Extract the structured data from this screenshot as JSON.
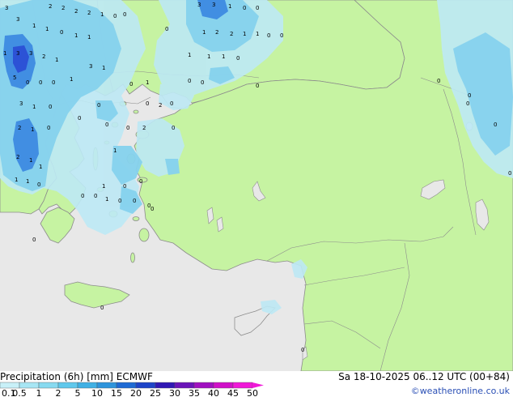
{
  "header": {
    "title": "Precipitation (6h) [mm] ECMWF",
    "valid_time": "Sa 18-10-2025 06..12 UTC (00+84)",
    "credit": "©weatheronline.co.uk"
  },
  "legend": {
    "ticks": [
      "0.1",
      "0.5",
      "1",
      "2",
      "5",
      "10",
      "15",
      "20",
      "25",
      "30",
      "35",
      "40",
      "45",
      "50"
    ],
    "colors": [
      "#c8f0f8",
      "#a8e6f4",
      "#88daf0",
      "#60c8ec",
      "#40b0e4",
      "#2e94dc",
      "#1e6ad4",
      "#1e44c8",
      "#3018b4",
      "#6a14b8",
      "#a010c0",
      "#d010c8",
      "#f018d8"
    ]
  },
  "colors": {
    "sea": "#e8e8e8",
    "land": "#c6f3a2",
    "coast": "#8c8c8c",
    "rain_light": "#bde9f5",
    "rain_mid": "#86d2ee",
    "rain_heavy": "#3a86e0",
    "rain_core": "#2c52d6",
    "credit": "#2a4fb5"
  },
  "map": {
    "values": [
      {
        "t": "3"
      },
      {
        "t": "2"
      },
      {
        "t": "2"
      },
      {
        "t": "2"
      },
      {
        "t": "2"
      },
      {
        "t": "1"
      },
      {
        "t": "0"
      },
      {
        "t": "0"
      },
      {
        "t": "3"
      },
      {
        "t": "3"
      },
      {
        "t": "1"
      },
      {
        "t": "0"
      },
      {
        "t": "0"
      },
      {
        "t": "3"
      },
      {
        "t": "1"
      },
      {
        "t": "1"
      },
      {
        "t": "0"
      },
      {
        "t": "1"
      },
      {
        "t": "1"
      },
      {
        "t": "1"
      },
      {
        "t": "2"
      },
      {
        "t": "2"
      },
      {
        "t": "1"
      },
      {
        "t": "1"
      },
      {
        "t": "0"
      },
      {
        "t": "0"
      },
      {
        "t": "0"
      },
      {
        "t": "1"
      },
      {
        "t": "1"
      },
      {
        "t": "1"
      },
      {
        "t": "0"
      },
      {
        "t": "1"
      },
      {
        "t": "3"
      },
      {
        "t": "3"
      },
      {
        "t": "2"
      },
      {
        "t": "1"
      },
      {
        "t": "3"
      },
      {
        "t": "1"
      },
      {
        "t": "5"
      },
      {
        "t": "0"
      },
      {
        "t": "0"
      },
      {
        "t": "0"
      },
      {
        "t": "1"
      },
      {
        "t": "0"
      },
      {
        "t": "1"
      },
      {
        "t": "0"
      },
      {
        "t": "0"
      },
      {
        "t": "3"
      },
      {
        "t": "1"
      },
      {
        "t": "0"
      },
      {
        "t": "0"
      },
      {
        "t": "2"
      },
      {
        "t": "0"
      },
      {
        "t": "2"
      },
      {
        "t": "1"
      },
      {
        "t": "0"
      },
      {
        "t": "2"
      },
      {
        "t": "0"
      },
      {
        "t": "0"
      },
      {
        "t": "0"
      },
      {
        "t": "0"
      },
      {
        "t": "0"
      },
      {
        "t": "1"
      },
      {
        "t": "2"
      },
      {
        "t": "1"
      },
      {
        "t": "1"
      },
      {
        "t": "1"
      },
      {
        "t": "0"
      },
      {
        "t": "1"
      },
      {
        "t": "1"
      },
      {
        "t": "0"
      },
      {
        "t": "0"
      },
      {
        "t": "0"
      },
      {
        "t": "0"
      },
      {
        "t": "0"
      },
      {
        "t": "1"
      },
      {
        "t": "0"
      },
      {
        "t": "0"
      },
      {
        "t": "0"
      },
      {
        "t": "0"
      },
      {
        "t": "0"
      },
      {
        "t": "0"
      },
      {
        "t": "0"
      },
      {
        "t": "0"
      },
      {
        "t": "0"
      },
      {
        "t": "0"
      },
      {
        "t": "0"
      },
      {
        "t": "0"
      }
    ]
  }
}
